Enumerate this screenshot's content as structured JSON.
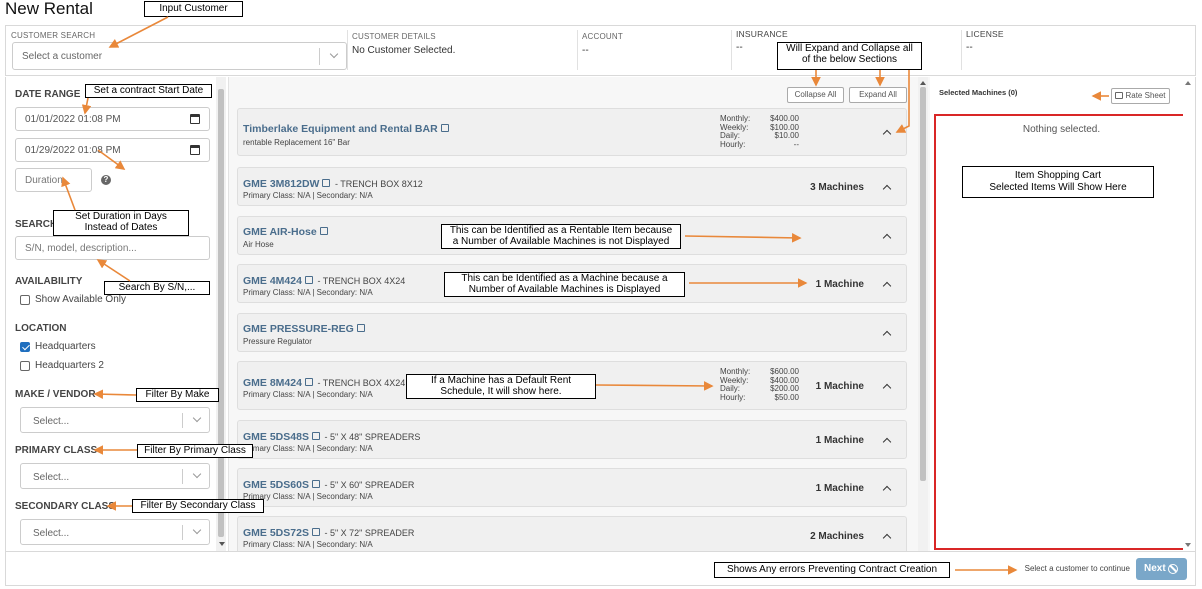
{
  "page": {
    "title": "New Rental"
  },
  "customer": {
    "search_label": "CUSTOMER SEARCH",
    "placeholder": "Select a customer",
    "details_label": "CUSTOMER DETAILS",
    "details_value": "No Customer Selected.",
    "account_label": "ACCOUNT",
    "account_value": "--",
    "insurance_label": "INSURANCE",
    "insurance_value": "--",
    "license_label": "LICENSE",
    "license_value": "--"
  },
  "filters": {
    "date_range_label": "DATE RANGE",
    "start_date": "01/01/2022 01:08 PM",
    "end_date": "01/29/2022 01:08 PM",
    "duration_placeholder": "Duration",
    "search_label": "SEARCH",
    "search_placeholder": "S/N, model, description...",
    "availability_label": "AVAILABILITY",
    "show_available_label": "Show Available Only",
    "location_label": "LOCATION",
    "locations": [
      {
        "label": "Headquarters",
        "checked": true
      },
      {
        "label": "Headquarters 2",
        "checked": false
      }
    ],
    "make_label": "MAKE / VENDOR",
    "make_placeholder": "Select...",
    "primary_label": "PRIMARY CLASS",
    "primary_placeholder": "Select...",
    "secondary_label": "SECONDARY CLASS",
    "secondary_placeholder": "Select..."
  },
  "list": {
    "collapse_all": "Collapse All",
    "expand_all": "Expand All",
    "items": [
      {
        "name": "Timberlake Equipment and Rental BAR",
        "desc": "",
        "sub": "rentable Replacement 16\" Bar",
        "count": "",
        "rates": {
          "Monthly:": "$400.00",
          "Weekly:": "$100.00",
          "Daily:": "$10.00",
          "Hourly:": "--"
        }
      },
      {
        "name": "GME 3M812DW",
        "desc": " - TRENCH BOX 8X12",
        "sub": "Primary Class: N/A | Secondary: N/A",
        "count": "3 Machines"
      },
      {
        "name": "GME AIR-Hose",
        "desc": "",
        "sub": "Air Hose",
        "count": ""
      },
      {
        "name": "GME 4M424",
        "desc": " - TRENCH BOX 4X24",
        "sub": "Primary Class: N/A | Secondary: N/A",
        "count": "1 Machine"
      },
      {
        "name": "GME PRESSURE-REG",
        "desc": "",
        "sub": "Pressure Regulator",
        "count": ""
      },
      {
        "name": "GME 8M424",
        "desc": " - TRENCH BOX 4X24",
        "sub": "Primary Class: N/A | Secondary: N/A",
        "count": "1 Machine",
        "rates": {
          "Monthly:": "$600.00",
          "Weekly:": "$400.00",
          "Daily:": "$200.00",
          "Hourly:": "$50.00"
        }
      },
      {
        "name": "GME 5DS48S",
        "desc": " - 5\" X 48\" SPREADERS",
        "sub": "Primary Class: N/A | Secondary: N/A",
        "count": "1 Machine"
      },
      {
        "name": "GME 5DS60S",
        "desc": " - 5\" X 60\" SPREADER",
        "sub": "Primary Class: N/A | Secondary: N/A",
        "count": "1 Machine"
      },
      {
        "name": "GME 5DS72S",
        "desc": " - 5\" X 72\" SPREADER",
        "sub": "Primary Class: N/A | Secondary: N/A",
        "count": "2 Machines"
      }
    ]
  },
  "cart": {
    "title": "Selected Machines (0)",
    "rate_sheet": "Rate Sheet",
    "empty": "Nothing selected."
  },
  "footer": {
    "message": "Select a customer to continue",
    "next": "Next"
  },
  "notes": {
    "input_customer": "Input Customer",
    "expand_collapse": "Will Expand and Collapse all\nof the below Sections",
    "start_date": "Set a contract Start Date",
    "duration": "Set Duration in Days\nInstead of Dates",
    "search": "Search By S/N,...",
    "make": "Filter By Make",
    "primary": "Filter By Primary Class",
    "secondary": "Filter By Secondary Class",
    "rentable": "This can be Identified as a Rentable Item because\na Number of Available Machines is not Displayed",
    "machine": "This can be Identified as a Machine because a\nNumber of Available Machines is Displayed",
    "default_rent": "If a Machine has a Default Rent\nSchedule, It will show here.",
    "cart": "Item Shopping Cart\nSelected Items Will Show Here",
    "errors": "Shows Any errors Preventing Contract Creation"
  },
  "colors": {
    "accent": "#4a6d8c",
    "cart_border": "#d92626",
    "next_button": "#7aa7c9",
    "arrow": "#e9883a"
  }
}
